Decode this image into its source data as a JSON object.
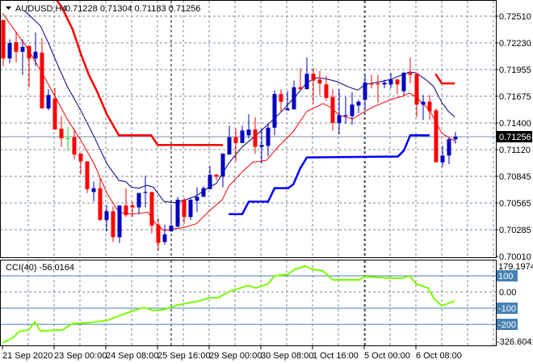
{
  "header": {
    "symbol_label": "AUDUSD,H4",
    "ohlc": "0.71228 0.71304 0.71183 0.71256"
  },
  "colors": {
    "bull": "#0000C0",
    "bear": "#FF0000",
    "doji": "#00E000",
    "ma_fast": "#FF0000",
    "ma_slow": "#000080",
    "step_upper": "#FF0000",
    "step_lower": "#0000FF",
    "cci": "#7CFC00",
    "cci_levels": "#4682B4",
    "grid": "#778899",
    "current_price_bg": "#000000"
  },
  "chart_data": [
    {
      "type": "candlestick",
      "title": "AUDUSD,H4",
      "ylim": [
        0.7001,
        0.7251
      ],
      "price_tick_labels": [
        "0.72510",
        "0.72230",
        "0.71955",
        "0.71675",
        "0.71400",
        "0.71120",
        "0.70845",
        "0.70565",
        "0.70285",
        "0.70010"
      ],
      "current_price": "0.71256",
      "x_tick_labels": [
        "21 Sep 2020",
        "23 Sep 00:00",
        "24 Sep 08:00",
        "25 Sep 16:00",
        "29 Sep 00:00",
        "30 Sep 08:00",
        "1 Oct 16:00",
        "5 Oct 00:00",
        "6 Oct 08:00"
      ],
      "candles_ohlc": [
        [
          0.7247,
          0.7247,
          0.7199,
          0.7207
        ],
        [
          0.7207,
          0.7227,
          0.7202,
          0.7223
        ],
        [
          0.7224,
          0.7235,
          0.7203,
          0.7214
        ],
        [
          0.7214,
          0.7227,
          0.719,
          0.7219
        ],
        [
          0.722,
          0.722,
          0.7177,
          0.7207
        ],
        [
          0.7207,
          0.7234,
          0.7199,
          0.7214
        ],
        [
          0.7213,
          0.7228,
          0.7155,
          0.7155
        ],
        [
          0.7155,
          0.7175,
          0.7153,
          0.7169
        ],
        [
          0.7165,
          0.7176,
          0.7133,
          0.7133
        ],
        [
          0.7134,
          0.7147,
          0.7115,
          0.7124
        ],
        [
          0.7124,
          0.7136,
          0.7111,
          0.7124
        ],
        [
          0.7125,
          0.7134,
          0.7102,
          0.7107
        ],
        [
          0.7108,
          0.7108,
          0.7086,
          0.71
        ],
        [
          0.71,
          0.71,
          0.7067,
          0.7071
        ],
        [
          0.7068,
          0.7079,
          0.7058,
          0.7072
        ],
        [
          0.7072,
          0.7083,
          0.7038,
          0.7039
        ],
        [
          0.7039,
          0.7054,
          0.7027,
          0.7048
        ],
        [
          0.7048,
          0.7053,
          0.7016,
          0.7021
        ],
        [
          0.7021,
          0.7054,
          0.7015,
          0.7054
        ],
        [
          0.7054,
          0.7072,
          0.7042,
          0.7044
        ],
        [
          0.7054,
          0.7058,
          0.7042,
          0.7052
        ],
        [
          0.7052,
          0.7067,
          0.7045,
          0.7067
        ],
        [
          0.7067,
          0.7085,
          0.7052,
          0.7068
        ],
        [
          0.7068,
          0.7068,
          0.7025,
          0.7033
        ],
        [
          0.7034,
          0.7041,
          0.7007,
          0.7015
        ],
        [
          0.7016,
          0.7034,
          0.7013,
          0.7024
        ],
        [
          0.7027,
          0.7053,
          0.7027,
          0.7033
        ],
        [
          0.7032,
          0.7063,
          0.7031,
          0.706
        ],
        [
          0.706,
          0.7062,
          0.7035,
          0.7042
        ],
        [
          0.7042,
          0.7062,
          0.7039,
          0.706
        ],
        [
          0.7059,
          0.7073,
          0.7047,
          0.7063
        ],
        [
          0.7063,
          0.7074,
          0.7063,
          0.7072
        ],
        [
          0.7071,
          0.7095,
          0.7071,
          0.7086
        ],
        [
          0.7086,
          0.7087,
          0.708,
          0.7084
        ],
        [
          0.7084,
          0.7108,
          0.7073,
          0.7108
        ],
        [
          0.7107,
          0.7137,
          0.7107,
          0.7125
        ],
        [
          0.7125,
          0.7134,
          0.71,
          0.7119
        ],
        [
          0.7119,
          0.7137,
          0.7119,
          0.7132
        ],
        [
          0.7127,
          0.7149,
          0.7124,
          0.7133
        ],
        [
          0.7133,
          0.7146,
          0.7108,
          0.7115
        ],
        [
          0.7115,
          0.7134,
          0.7098,
          0.7117
        ],
        [
          0.7116,
          0.7139,
          0.7105,
          0.7135
        ],
        [
          0.7135,
          0.7174,
          0.7127,
          0.717
        ],
        [
          0.717,
          0.7175,
          0.7151,
          0.7162
        ],
        [
          0.7153,
          0.7173,
          0.7153,
          0.7155
        ],
        [
          0.7154,
          0.7184,
          0.7154,
          0.7177
        ],
        [
          0.7177,
          0.7197,
          0.7175,
          0.7175
        ],
        [
          0.7175,
          0.7208,
          0.7175,
          0.7191
        ],
        [
          0.7191,
          0.7197,
          0.716,
          0.7184
        ],
        [
          0.7185,
          0.7194,
          0.7169,
          0.7181
        ],
        [
          0.718,
          0.7189,
          0.7163,
          0.7166
        ],
        [
          0.7167,
          0.7175,
          0.7132,
          0.714
        ],
        [
          0.714,
          0.7175,
          0.7128,
          0.7148
        ],
        [
          0.7147,
          0.7167,
          0.7139,
          0.7148
        ],
        [
          0.7147,
          0.7172,
          0.7138,
          0.7159
        ],
        [
          0.7158,
          0.7164,
          0.715,
          0.7162
        ],
        [
          0.7164,
          0.7191,
          0.7153,
          0.7182
        ],
        [
          0.7181,
          0.719,
          0.7176,
          0.718
        ],
        [
          0.7181,
          0.719,
          0.7161,
          0.718
        ],
        [
          0.718,
          0.7185,
          0.7176,
          0.7182
        ],
        [
          0.718,
          0.7192,
          0.7176,
          0.7185
        ],
        [
          0.7185,
          0.7186,
          0.717,
          0.718
        ],
        [
          0.7173,
          0.7193,
          0.7169,
          0.7192
        ],
        [
          0.7192,
          0.7208,
          0.7181,
          0.719
        ],
        [
          0.7191,
          0.7192,
          0.7146,
          0.7159
        ],
        [
          0.7159,
          0.7169,
          0.7143,
          0.7162
        ],
        [
          0.7162,
          0.7169,
          0.7143,
          0.7152
        ],
        [
          0.7153,
          0.7155,
          0.7099,
          0.7099
        ],
        [
          0.7099,
          0.7116,
          0.7094,
          0.7106
        ],
        [
          0.7106,
          0.7125,
          0.7097,
          0.7123
        ],
        [
          0.71228,
          0.71304,
          0.71183,
          0.71256
        ]
      ],
      "overlays": [
        {
          "name": "ma-fast",
          "width": "thin",
          "color_key": "ma_fast",
          "segments": [
            [
              [
                0.9,
                0.7254
              ],
              [
                4.6,
                0.7219
              ],
              [
                6.75,
                0.7195
              ],
              [
                8.9,
                0.7169
              ],
              [
                10.9,
                0.7144
              ],
              [
                13,
                0.7122
              ],
              [
                15.1,
                0.7097
              ],
              [
                17.1,
                0.7066
              ],
              [
                18.9,
                0.7047
              ],
              [
                20.9,
                0.7045
              ],
              [
                23.4,
                0.7047
              ],
              [
                24.6,
                0.7035
              ],
              [
                25.9,
                0.7028
              ],
              [
                28.9,
                0.7031
              ],
              [
                30.9,
                0.7035
              ],
              [
                33,
                0.7049
              ],
              [
                34.9,
                0.706
              ],
              [
                35.9,
                0.7074
              ],
              [
                38,
                0.7089
              ],
              [
                39.6,
                0.7099
              ],
              [
                41.75,
                0.7101
              ],
              [
                43.4,
                0.7114
              ],
              [
                45.9,
                0.7131
              ],
              [
                48,
                0.7152
              ],
              [
                49.25,
                0.7156
              ],
              [
                50.5,
                0.716
              ],
              [
                51.75,
                0.7156
              ],
              [
                53,
                0.7148
              ],
              [
                55.1,
                0.7144
              ],
              [
                57,
                0.7152
              ],
              [
                58.4,
                0.7157
              ],
              [
                60.9,
                0.7164
              ],
              [
                62.9,
                0.7168
              ],
              [
                63.9,
                0.7171
              ],
              [
                64.9,
                0.7167
              ],
              [
                67,
                0.7153
              ],
              [
                68.9,
                0.7129
              ],
              [
                70.9,
                0.7121
              ]
            ]
          ]
        },
        {
          "name": "ma-slow",
          "width": "thin",
          "color_key": "ma_slow",
          "segments": [
            [
              [
                4.25,
                0.7257
              ],
              [
                6.75,
                0.7241
              ],
              [
                8,
                0.7223
              ],
              [
                9.25,
                0.7203
              ],
              [
                10.9,
                0.7178
              ],
              [
                13,
                0.7153
              ],
              [
                15.1,
                0.7125
              ],
              [
                17.1,
                0.7097
              ],
              [
                18.9,
                0.708
              ],
              [
                19.9,
                0.7079
              ],
              [
                20.9,
                0.7073
              ],
              [
                22,
                0.7072
              ],
              [
                23.25,
                0.7075
              ],
              [
                24.25,
                0.7073
              ],
              [
                25.9,
                0.7058
              ],
              [
                27.6,
                0.7057
              ],
              [
                29.25,
                0.706
              ],
              [
                30.9,
                0.7064
              ],
              [
                32.6,
                0.7072
              ],
              [
                34,
                0.7077
              ],
              [
                35.9,
                0.7098
              ],
              [
                38,
                0.7115
              ],
              [
                40.1,
                0.7127
              ],
              [
                42.1,
                0.7139
              ],
              [
                44.25,
                0.7153
              ],
              [
                46.4,
                0.7169
              ],
              [
                48,
                0.7182
              ],
              [
                49.6,
                0.7187
              ],
              [
                50.9,
                0.7186
              ],
              [
                52.6,
                0.7183
              ],
              [
                54.6,
                0.7177
              ],
              [
                55.9,
                0.7174
              ],
              [
                57,
                0.718
              ],
              [
                58,
                0.7181
              ],
              [
                60.9,
                0.7185
              ],
              [
                63.9,
                0.7193
              ],
              [
                64.9,
                0.7192
              ],
              [
                66.4,
                0.7185
              ],
              [
                67.6,
                0.7178
              ],
              [
                68.9,
                0.7161
              ],
              [
                69.9,
                0.7152
              ],
              [
                70.9,
                0.7146
              ]
            ]
          ]
        },
        {
          "name": "step-upper",
          "width": "thick",
          "color_key": "step_upper",
          "segments": [
            [
              [
                9.25,
                0.7268
              ],
              [
                10.1,
                0.726
              ],
              [
                11.75,
                0.7237
              ],
              [
                13,
                0.7212
              ],
              [
                14.25,
                0.719
              ],
              [
                15.5,
                0.7173
              ],
              [
                17.1,
                0.7148
              ],
              [
                18.9,
                0.7127
              ],
              [
                23.9,
                0.7127
              ],
              [
                24.9,
                0.7117
              ],
              [
                35,
                0.7117
              ]
            ],
            [
              [
                67.9,
                0.7191
              ],
              [
                68.9,
                0.7181
              ],
              [
                70.9,
                0.7181
              ]
            ]
          ]
        },
        {
          "name": "step-lower",
          "width": "thick",
          "color_key": "step_lower",
          "segments": [
            [
              [
                35.9,
                0.7045
              ],
              [
                38,
                0.7045
              ],
              [
                39,
                0.7058
              ],
              [
                42,
                0.7058
              ],
              [
                43,
                0.7072
              ],
              [
                45.1,
                0.7072
              ],
              [
                45.9,
                0.7076
              ],
              [
                47,
                0.7093
              ],
              [
                48,
                0.7104
              ],
              [
                62.1,
                0.7105
              ],
              [
                63,
                0.7111
              ],
              [
                64,
                0.7127
              ],
              [
                67,
                0.7127
              ]
            ]
          ]
        }
      ]
    },
    {
      "type": "line",
      "title": "CCI(40) -56.0164",
      "ylim": [
        -326.6041,
        179.1974
      ],
      "max_label": "179.1974",
      "min_label": "-326.6041",
      "zero_label": "0.00",
      "levels": [
        {
          "value": 100,
          "label": "100"
        },
        {
          "value": -100,
          "label": "-100"
        },
        {
          "value": -200,
          "label": "-200"
        }
      ],
      "points": [
        [
          0.9,
          -315
        ],
        [
          2.6,
          -280
        ],
        [
          3.4,
          -245
        ],
        [
          4.9,
          -235
        ],
        [
          5.9,
          -185
        ],
        [
          6.75,
          -240
        ],
        [
          10.1,
          -235
        ],
        [
          11.75,
          -195
        ],
        [
          14.25,
          -190
        ],
        [
          17.1,
          -175
        ],
        [
          20.1,
          -130
        ],
        [
          22.75,
          -95
        ],
        [
          24.25,
          -115
        ],
        [
          25.75,
          -110
        ],
        [
          28,
          -80
        ],
        [
          31.4,
          -55
        ],
        [
          33,
          -35
        ],
        [
          34.25,
          -35
        ],
        [
          36.1,
          5
        ],
        [
          38.9,
          40
        ],
        [
          40.1,
          25
        ],
        [
          42,
          50
        ],
        [
          43,
          100
        ],
        [
          45.1,
          110
        ],
        [
          46.1,
          140
        ],
        [
          47.75,
          160
        ],
        [
          48.9,
          140
        ],
        [
          50.5,
          130
        ],
        [
          52,
          75
        ],
        [
          56.1,
          75
        ],
        [
          57,
          95
        ],
        [
          61.4,
          85
        ],
        [
          62.75,
          85
        ],
        [
          63.9,
          100
        ],
        [
          64.9,
          50
        ],
        [
          66.75,
          25
        ],
        [
          67.75,
          -45
        ],
        [
          68.9,
          -85
        ],
        [
          69.9,
          -70
        ],
        [
          70.9,
          -56
        ]
      ]
    }
  ]
}
